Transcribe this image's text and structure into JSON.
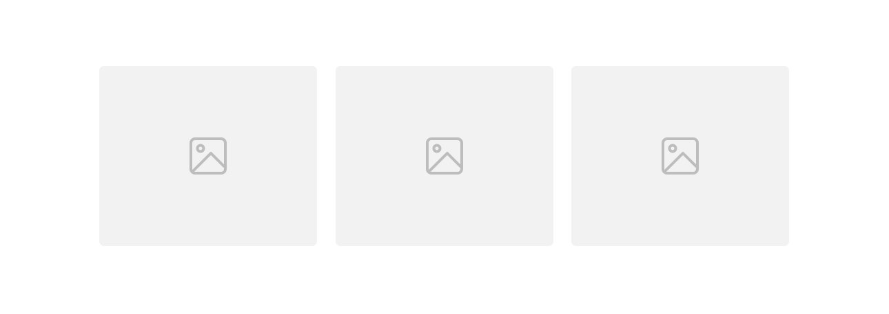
{
  "gallery": {
    "cards": [
      {
        "kind": "image-placeholder",
        "icon": "image-placeholder-icon"
      },
      {
        "kind": "image-placeholder",
        "icon": "image-placeholder-icon"
      },
      {
        "kind": "image-placeholder",
        "icon": "image-placeholder-icon"
      }
    ]
  },
  "colors": {
    "background": "#ffffff",
    "card_background": "#f2f2f2",
    "icon_stroke": "#bdbdbd"
  }
}
